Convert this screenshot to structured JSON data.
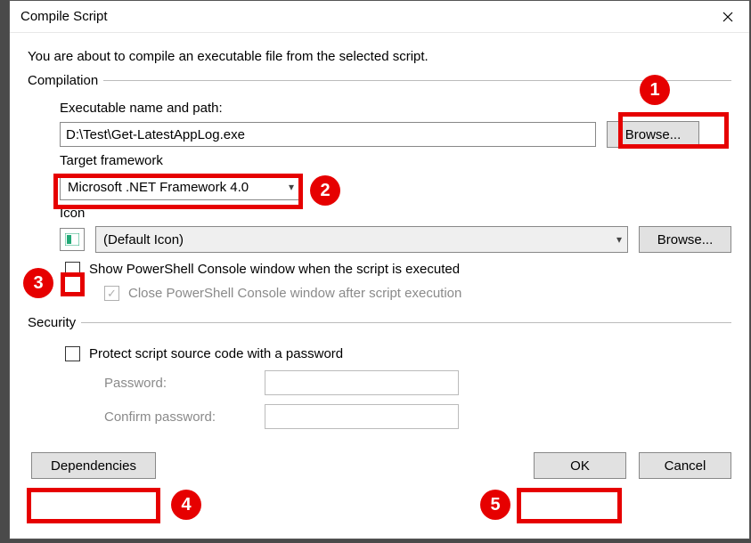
{
  "window": {
    "title": "Compile Script"
  },
  "intro": "You are about to compile an executable file from the selected script.",
  "compilation": {
    "legend": "Compilation",
    "exe_label": "Executable name and path:",
    "exe_value": "D:\\Test\\Get-LatestAppLog.exe",
    "browse_exe": "Browse...",
    "target_label": "Target framework",
    "target_value": "Microsoft .NET Framework 4.0",
    "icon_label": "Icon",
    "icon_value": "(Default Icon)",
    "browse_icon": "Browse...",
    "show_console": "Show PowerShell Console window when the script is executed",
    "show_console_checked": false,
    "close_console": "Close PowerShell Console window after script execution",
    "close_console_checked": true,
    "close_console_enabled": false
  },
  "security": {
    "legend": "Security",
    "protect": "Protect script source code with a password",
    "protect_checked": false,
    "password_label": "Password:",
    "confirm_label": "Confirm password:"
  },
  "footer": {
    "dependencies": "Dependencies",
    "ok": "OK",
    "cancel": "Cancel"
  },
  "callouts": {
    "c1": "1",
    "c2": "2",
    "c3": "3",
    "c4": "4",
    "c5": "5"
  }
}
